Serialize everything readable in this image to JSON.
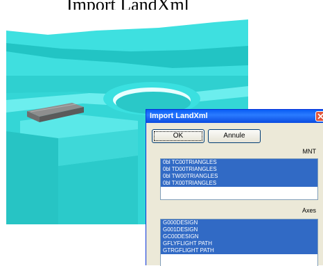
{
  "caption": "Import LandXml",
  "dialog": {
    "title": "Import LandXml",
    "ok_label": "OK",
    "cancel_label": "Annule",
    "mnt_label": "MNT",
    "axes_label": "Axes",
    "mnt_items": [
      "0bl TC00TRIANGLES",
      "0bl TD00TRIANGLES",
      "0bl TW00TRIANGLES",
      "0bl TX00TRIANGLES"
    ],
    "axes_items": [
      "G000DESIGN",
      "G001DESIGN",
      "GC00DESIGN",
      "GFLYFLIGHT PATH",
      "GTRGFLIGHT PATH"
    ]
  },
  "colors": {
    "terrain": "#28c8c8",
    "selection": "#316ac5",
    "titlebar": "#0a5df5"
  }
}
